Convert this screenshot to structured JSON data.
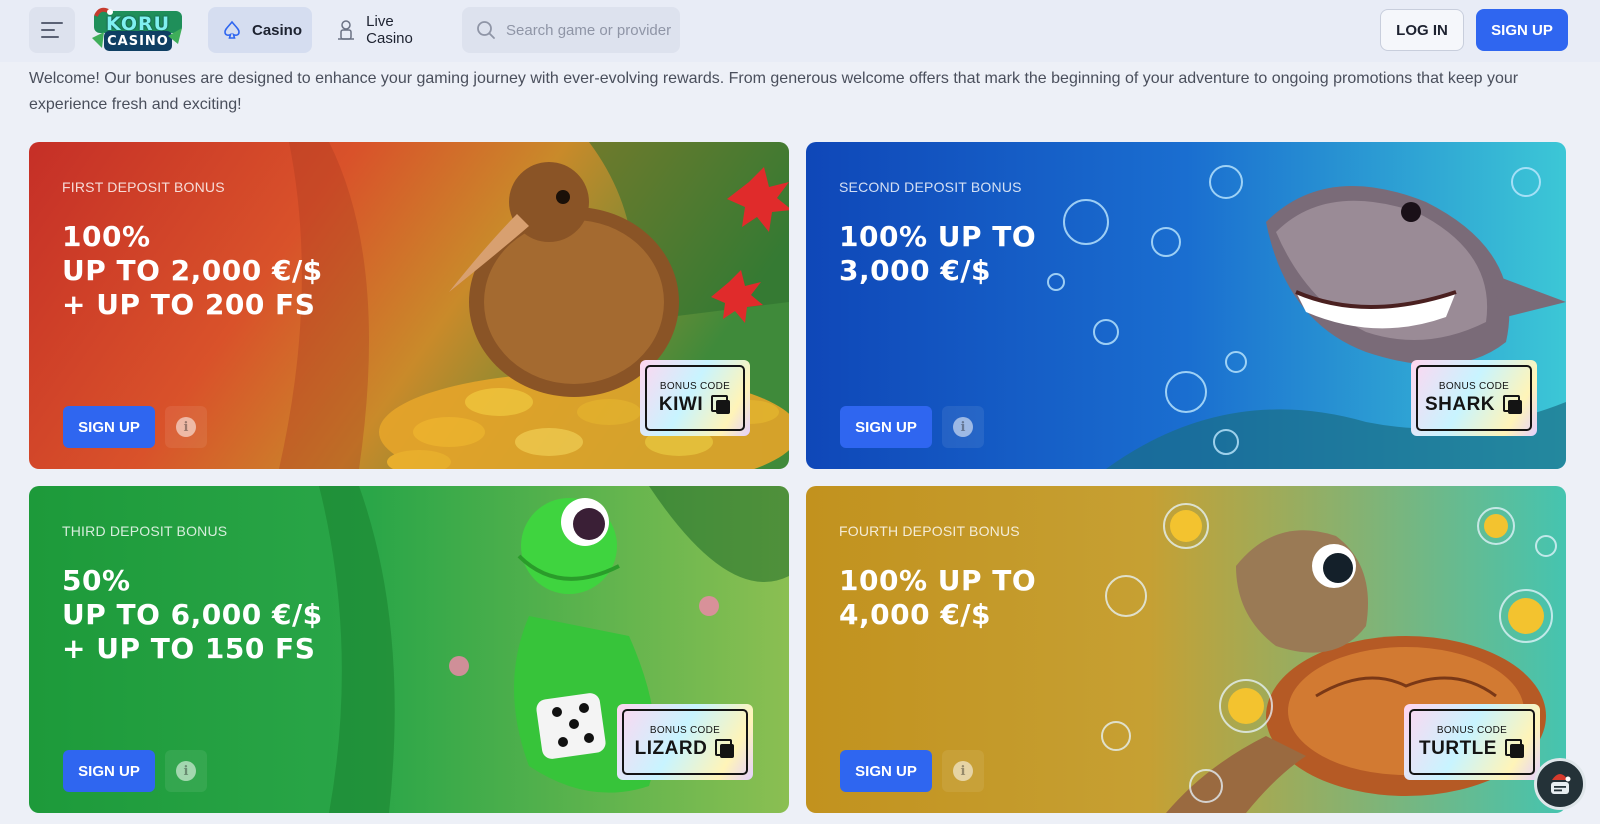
{
  "header": {
    "logo_text_top": "KORU",
    "logo_text_bottom": "CASINO",
    "tabs": [
      {
        "label": "Casino",
        "icon": "spade-icon",
        "active": true
      },
      {
        "label": "Live Casino",
        "icon": "dealer-icon",
        "active": false
      }
    ],
    "search_placeholder": "Search game or provider",
    "login_label": "LOG IN",
    "signup_label": "SIGN UP"
  },
  "intro": "Welcome! Our bonuses are designed to enhance your gaming journey with ever-evolving rewards. From generous welcome offers that mark the beginning of your adventure to ongoing promotions that keep your experience fresh and exciting!",
  "cards": [
    {
      "label": "FIRST DEPOSIT BONUS",
      "title": "100%\nUP TO 2,000 €/$\n+ UP TO 200 FS",
      "signup": "SIGN UP",
      "code_caption": "BONUS CODE",
      "code": "KIWI",
      "art": "kiwi-bird-illustration"
    },
    {
      "label": "SECOND DEPOSIT BONUS",
      "title": "100% UP TO\n3,000 €/$",
      "signup": "SIGN UP",
      "code_caption": "BONUS CODE",
      "code": "SHARK",
      "art": "shark-illustration"
    },
    {
      "label": "THIRD DEPOSIT BONUS",
      "title": "50%\nUP TO 6,000 €/$\n+ UP TO 150 FS",
      "signup": "SIGN UP",
      "code_caption": "BONUS CODE",
      "code": "LIZARD",
      "art": "lizard-illustration"
    },
    {
      "label": "FOURTH DEPOSIT BONUS",
      "title": "100% UP TO\n4,000 €/$",
      "signup": "SIGN UP",
      "code_caption": "BONUS CODE",
      "code": "TURTLE",
      "art": "turtle-illustration"
    }
  ],
  "colors": {
    "primary": "#2f66f0",
    "card1": "#c8372a",
    "card2": "#1a56c8",
    "card3": "#22a03a",
    "card4": "#c8921e"
  }
}
